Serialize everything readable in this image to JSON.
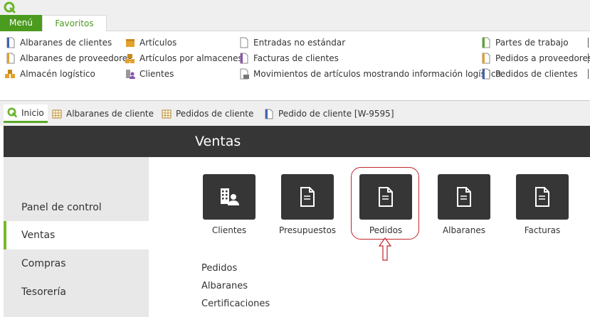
{
  "ribbon": {
    "tabs": [
      {
        "label": "Menú",
        "active": false
      },
      {
        "label": "Favoritos",
        "active": true
      }
    ]
  },
  "favorites": {
    "items": [
      {
        "label": "Albaranes de clientes",
        "icon": "document-blue-icon"
      },
      {
        "label": "Albaranes de proveedores",
        "icon": "document-orange-icon"
      },
      {
        "label": "Almacén logístico",
        "icon": "warehouse-icon"
      },
      {
        "label": "Artículos",
        "icon": "box-icon"
      },
      {
        "label": "Artículos por almacenes",
        "icon": "boxes-icon"
      },
      {
        "label": "Clientes",
        "icon": "clients-icon"
      },
      {
        "label": "Entradas no estándar",
        "icon": "document-blank-icon"
      },
      {
        "label": "Facturas de clientes",
        "icon": "document-purple-icon"
      },
      {
        "label": "Movimientos de artículos mostrando información logística",
        "icon": "document-list-icon"
      },
      {
        "label": "Partes de trabajo",
        "icon": "document-green-icon"
      },
      {
        "label": "Pedidos a proveedores",
        "icon": "document-orange-icon"
      },
      {
        "label": "Pedidos de clientes",
        "icon": "document-blue-icon"
      }
    ]
  },
  "doc_tabs": [
    {
      "label": "Inicio",
      "icon": "app-logo-icon",
      "active": true
    },
    {
      "label": "Albaranes de cliente",
      "icon": "grid-icon",
      "active": false
    },
    {
      "label": "Pedidos de cliente",
      "icon": "grid-icon",
      "active": false
    },
    {
      "label": "Pedido de cliente [W-9595]",
      "icon": "document-blue-icon",
      "active": false
    }
  ],
  "header": {
    "title": "Ventas"
  },
  "sidebar": {
    "items": [
      {
        "label": "Panel de control",
        "active": false
      },
      {
        "label": "Ventas",
        "active": true
      },
      {
        "label": "Compras",
        "active": false
      },
      {
        "label": "Tesorería",
        "active": false
      }
    ]
  },
  "tiles": [
    {
      "label": "Clientes",
      "icon": "clients-building-icon"
    },
    {
      "label": "Presupuestos",
      "icon": "document-icon"
    },
    {
      "label": "Pedidos",
      "icon": "document-icon"
    },
    {
      "label": "Albaranes",
      "icon": "document-icon"
    },
    {
      "label": "Facturas",
      "icon": "document-icon"
    }
  ],
  "links": [
    {
      "label": "Pedidos"
    },
    {
      "label": "Albaranes"
    },
    {
      "label": "Certificaciones"
    }
  ],
  "colors": {
    "accent_green": "#4b9b1f",
    "header_dark": "#363636",
    "highlight_red": "#c0262c"
  }
}
